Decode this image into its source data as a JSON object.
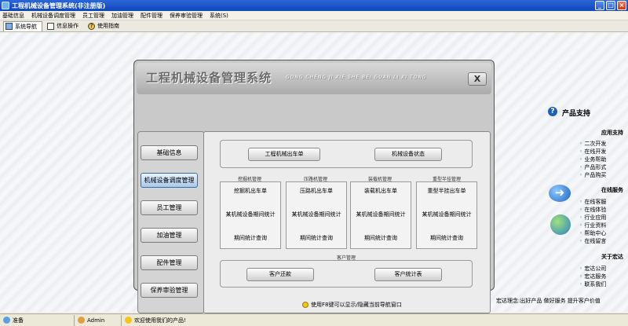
{
  "window": {
    "title": "工程机械设备管理系统(非注册版)"
  },
  "menu": [
    "基础信息",
    "机械设备调度管理",
    "员工管理",
    "加油管理",
    "配件管理",
    "保养审验管理",
    "系统(S)"
  ],
  "nav_tabs": [
    {
      "label": "系统导航",
      "icon": "monitor-icon"
    },
    {
      "label": "信息操作",
      "icon": "document-icon"
    },
    {
      "label": "使用指南",
      "icon": "help-icon"
    }
  ],
  "app": {
    "title": "工程机械设备管理系统",
    "subtitle": "GONG CHENG JI XIE SHE BEI GUAN LI XI TONG",
    "close_label": "X"
  },
  "left_nav": [
    "基础信息",
    "机械设备调度管理",
    "员工管理",
    "加油管理",
    "配件管理",
    "保养审验管理"
  ],
  "dispatch": {
    "top_buttons": [
      "工程机械出车单",
      "机械设备状态"
    ],
    "columns": [
      {
        "title": "挖掘机管理",
        "items": [
          "挖掘机出车单",
          "某机械设备期间统计",
          "期间统计查询"
        ]
      },
      {
        "title": "压路机管理",
        "items": [
          "压路机出车单",
          "某机械设备期间统计",
          "期间统计查询"
        ]
      },
      {
        "title": "装载机管理",
        "items": [
          "装载机出车单",
          "某机械设备期间统计",
          "期间统计查询"
        ]
      },
      {
        "title": "重型半挂管理",
        "items": [
          "重型半挂出车单",
          "某机械设备期间统计",
          "期间统计查询"
        ]
      }
    ],
    "customer": {
      "title": "客户管理",
      "buttons": [
        "客户还款",
        "客户统计表"
      ]
    },
    "hint": "使用F8键可以显示/隐藏当前导航窗口"
  },
  "support": {
    "title": "产品支持",
    "sections": [
      {
        "title": "应用支持",
        "links": [
          "二次开发",
          "在线开发",
          "业务帮助",
          "产品形式",
          "产品购买"
        ]
      },
      {
        "title": "在线服务",
        "links": [
          "在线客服",
          "在线体验",
          "行业应用",
          "行业资料",
          "帮助中心",
          "在线留言"
        ]
      },
      {
        "title": "关于宏达",
        "links": [
          "宏达公司",
          "宏达服务",
          "联系我们"
        ]
      }
    ],
    "motto": "宏达理念:出好产品 做好服务 提升客户价值"
  },
  "status": {
    "ready": "准备",
    "user": "Admin",
    "welcome": "欢迎使用我们的产品!"
  }
}
